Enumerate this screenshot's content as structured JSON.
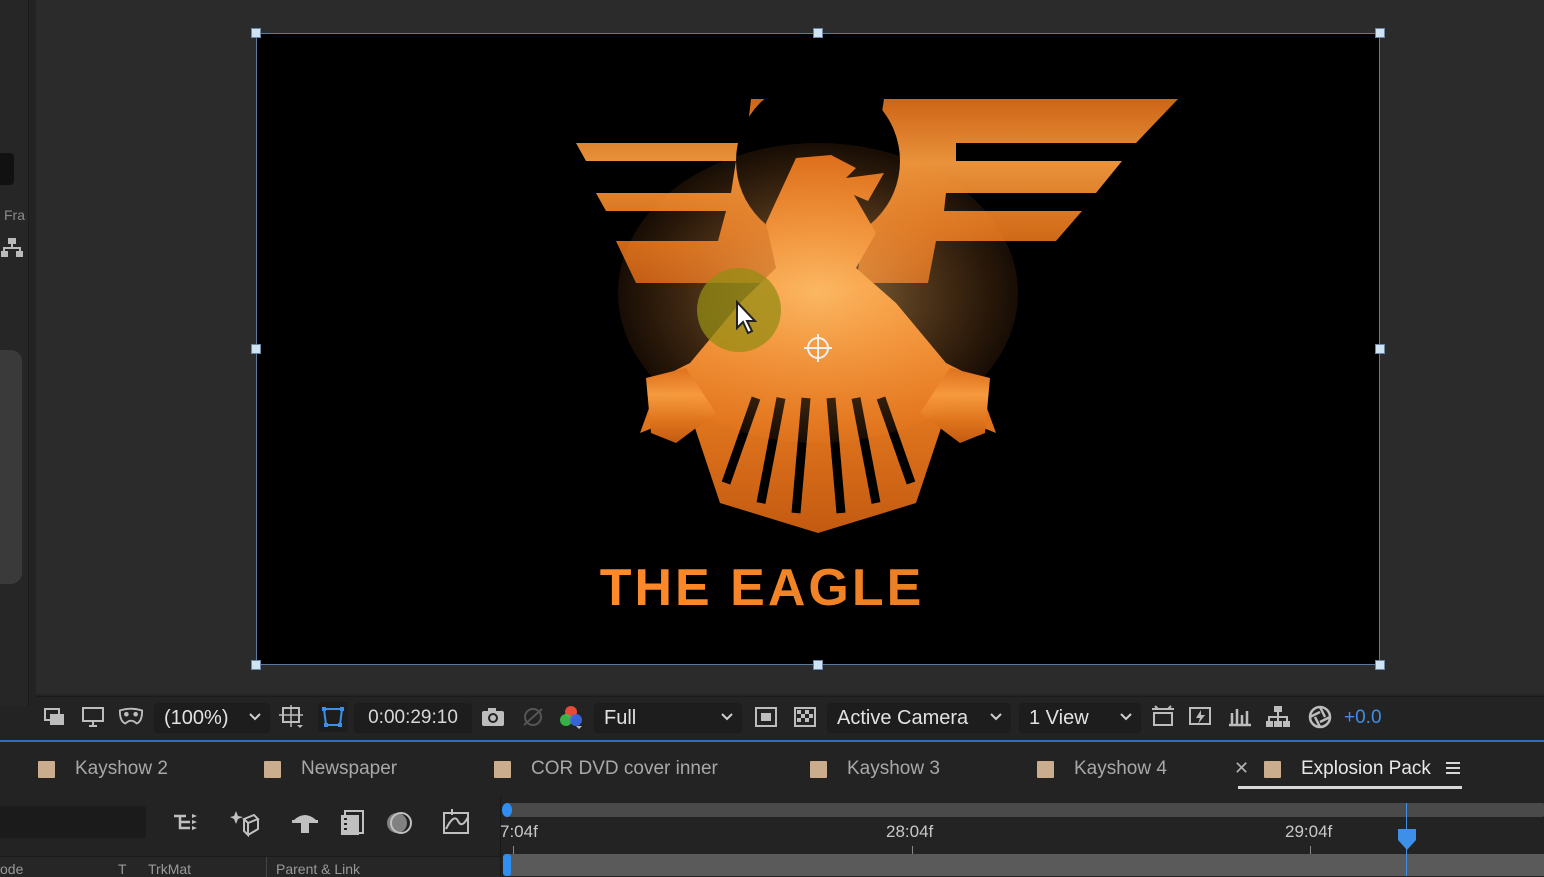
{
  "left_panel": {
    "label": "Fra"
  },
  "viewer": {
    "composition_title": "THE EAGLE"
  },
  "viewer_toolbar": {
    "zoom": "(100%)",
    "timecode": "0:00:29:10",
    "resolution": "Full",
    "camera": "Active Camera",
    "views": "1 View",
    "exposure": "+0.0"
  },
  "tabs": [
    {
      "label": "Kayshow 2"
    },
    {
      "label": "Newspaper"
    },
    {
      "label": "COR DVD cover inner"
    },
    {
      "label": "Kayshow 3"
    },
    {
      "label": "Kayshow 4"
    },
    {
      "label": "Explosion Pack",
      "active": true
    }
  ],
  "timeline": {
    "columns": {
      "mode": "ode",
      "t": "T",
      "trkmat": "TrkMat",
      "parent": "Parent & Link"
    },
    "ruler": [
      "7:04f",
      "28:04f",
      "29:04f"
    ]
  },
  "colors": {
    "accent": "#2f8ff0",
    "label_swatch": "#c9ad8c"
  }
}
